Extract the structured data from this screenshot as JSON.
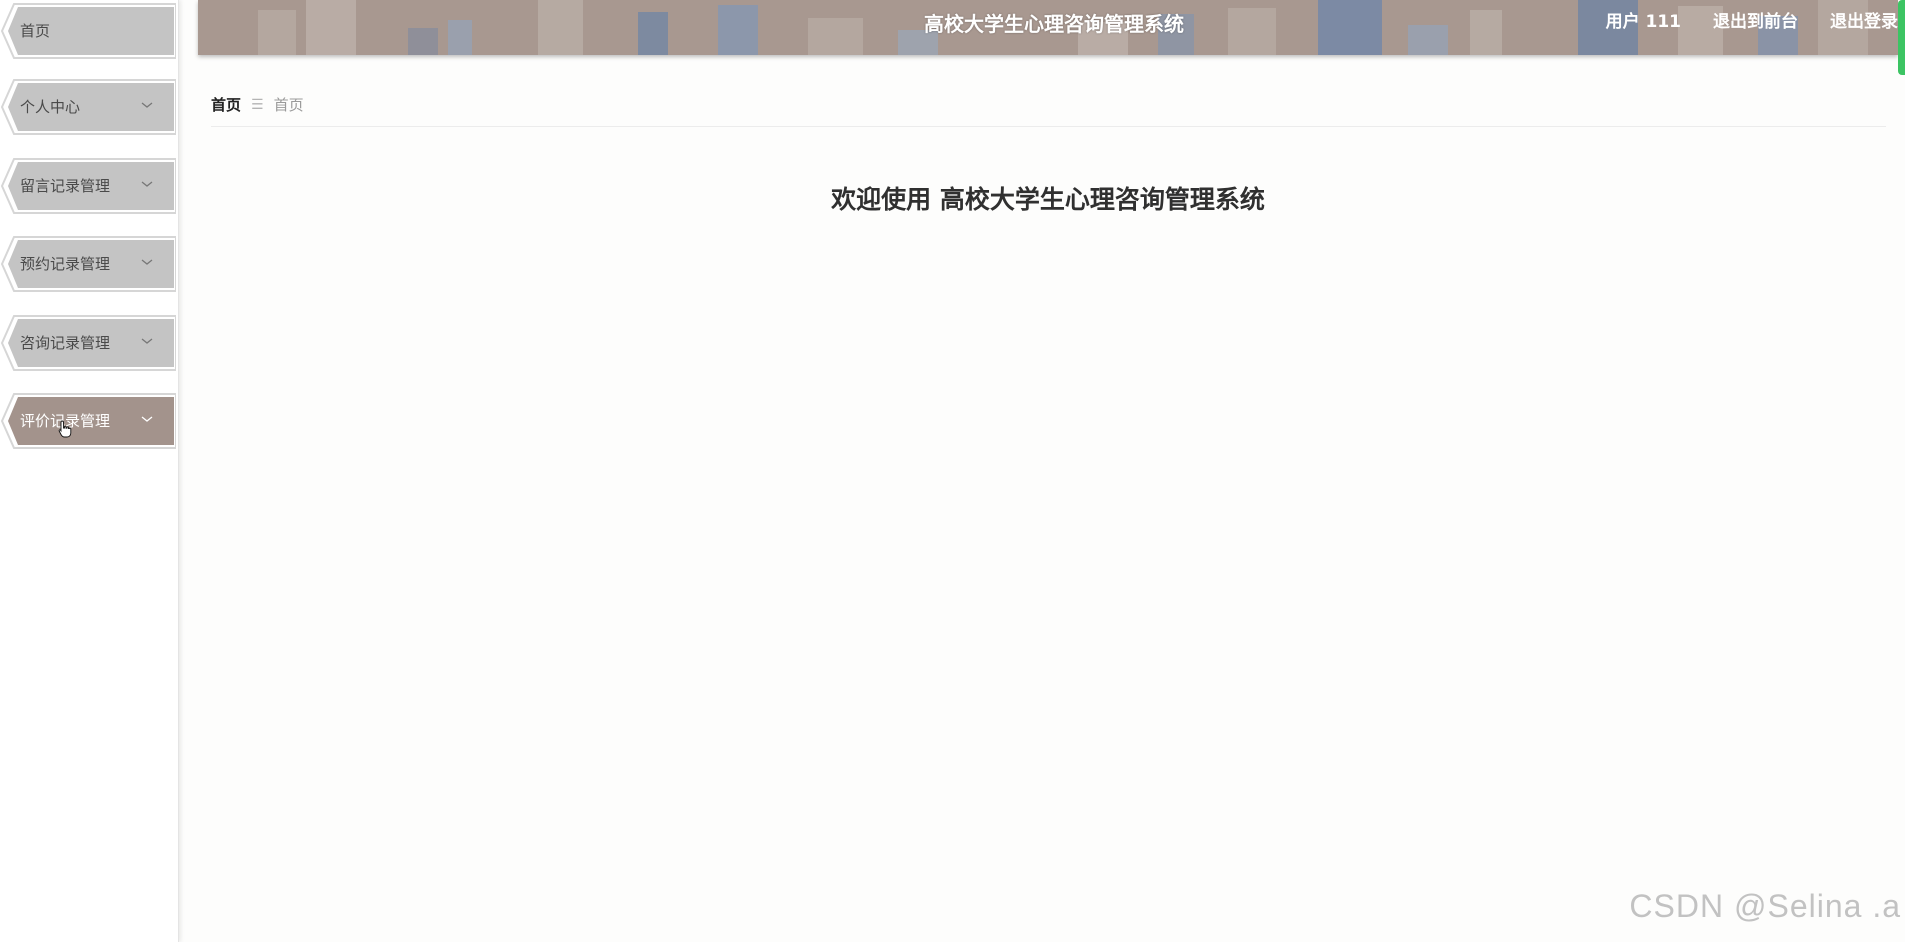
{
  "app": {
    "title": "高校大学生心理咨询管理系统",
    "welcome_prefix": "欢迎使用",
    "welcome_title": "高校大学生心理咨询管理系统"
  },
  "header": {
    "user_label": "用户 111",
    "to_front": "退出到前台",
    "logout": "退出登录"
  },
  "sidebar": {
    "items": [
      {
        "label": "首页",
        "has_submenu": false,
        "active": false
      },
      {
        "label": "个人中心",
        "has_submenu": true,
        "active": false
      },
      {
        "label": "留言记录管理",
        "has_submenu": true,
        "active": false
      },
      {
        "label": "预约记录管理",
        "has_submenu": true,
        "active": false
      },
      {
        "label": "咨询记录管理",
        "has_submenu": true,
        "active": false
      },
      {
        "label": "评价记录管理",
        "has_submenu": true,
        "active": true
      }
    ]
  },
  "breadcrumb": {
    "home": "首页",
    "separator_icon": "menu-lines-icon",
    "current": "首页"
  },
  "watermark": "CSDN @Selina .a",
  "colors": {
    "menu_item_bg": "#c4c4c4",
    "menu_item_active_bg": "#a3938c",
    "header_bg": "#a89890",
    "accent_green": "#3cc463"
  }
}
